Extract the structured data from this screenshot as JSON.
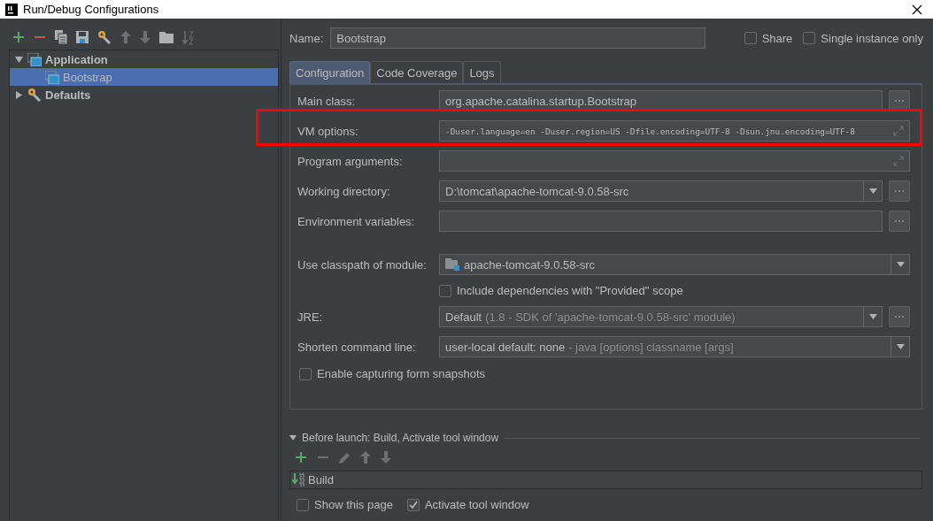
{
  "window": {
    "title": "Run/Debug Configurations"
  },
  "toolbar": [
    {
      "kind": "add",
      "disabled": false
    },
    {
      "kind": "remove",
      "disabled": false
    },
    {
      "kind": "copy",
      "disabled": false
    },
    {
      "kind": "save",
      "disabled": false
    },
    {
      "kind": "wrench",
      "disabled": false
    },
    {
      "kind": "up",
      "disabled": true
    },
    {
      "kind": "down",
      "disabled": true
    },
    {
      "kind": "folder",
      "disabled": false
    },
    {
      "kind": "sort",
      "disabled": true
    }
  ],
  "tree": [
    {
      "label": "Application",
      "kind": "application",
      "expanded": true,
      "selected": false,
      "children": [
        {
          "label": "Bootstrap",
          "kind": "application",
          "selected": true
        }
      ]
    },
    {
      "label": "Defaults",
      "kind": "defaults",
      "expanded": false,
      "selected": false
    }
  ],
  "name_field": {
    "label": "Name:",
    "value": "Bootstrap"
  },
  "header_options": [
    {
      "label": "Share",
      "checked": false
    },
    {
      "label": "Single instance only",
      "checked": false
    }
  ],
  "tabs": [
    {
      "label": "Configuration",
      "selected": true
    },
    {
      "label": "Code Coverage",
      "selected": false
    },
    {
      "label": "Logs",
      "selected": false
    }
  ],
  "form": [
    {
      "kind": "text",
      "label": "Main class:",
      "value": "org.apache.catalina.startup.Bootstrap",
      "browse": true,
      "highlighted": false
    },
    {
      "kind": "expand",
      "label": "VM options:",
      "value": "-Duser.language=en -Duser.region=US -Dfile.encoding=UTF-8 -Dsun.jnu.encoding=UTF-8",
      "browse": false,
      "highlighted": true
    },
    {
      "kind": "expand",
      "label": "Program arguments:",
      "browse": false,
      "highlighted": false
    },
    {
      "kind": "combo",
      "label": "Working directory:",
      "value": "D:\\tomcat\\apache-tomcat-9.0.58-src",
      "browse": true,
      "highlighted": false
    },
    {
      "kind": "text",
      "label": "Environment variables:",
      "browse": true,
      "highlighted": false
    },
    {
      "kind": "spacer"
    },
    {
      "kind": "module",
      "label": "Use classpath of module:",
      "value": "apache-tomcat-9.0.58-src",
      "browse": false,
      "highlighted": false
    },
    {
      "kind": "checkbox",
      "label": "Include dependencies with \"Provided\" scope",
      "checked": false
    },
    {
      "kind": "combo",
      "label": "JRE:",
      "value": "Default",
      "hint": "(1.8 - SDK of 'apache-tomcat-9.0.58-src' module)",
      "browse": true,
      "highlighted": false
    },
    {
      "kind": "combo",
      "label": "Shorten command line:",
      "value": "user-local default: none",
      "hint": "- java [options] classname [args]",
      "browse": false,
      "highlighted": false
    }
  ],
  "snapshot_option": {
    "label": "Enable capturing form snapshots",
    "checked": false
  },
  "before_launch": {
    "title": "Before launch: Build, Activate tool window",
    "expanded": true,
    "toolbar": [
      {
        "kind": "add",
        "disabled": false
      },
      {
        "kind": "remove",
        "disabled": true
      },
      {
        "kind": "edit",
        "disabled": true
      },
      {
        "kind": "up",
        "disabled": true
      },
      {
        "kind": "down",
        "disabled": true
      }
    ],
    "tasks": [
      {
        "label": "Build"
      }
    ]
  },
  "footer_options": [
    {
      "label": "Show this page",
      "checked": false
    },
    {
      "label": "Activate tool window",
      "checked": true
    }
  ]
}
